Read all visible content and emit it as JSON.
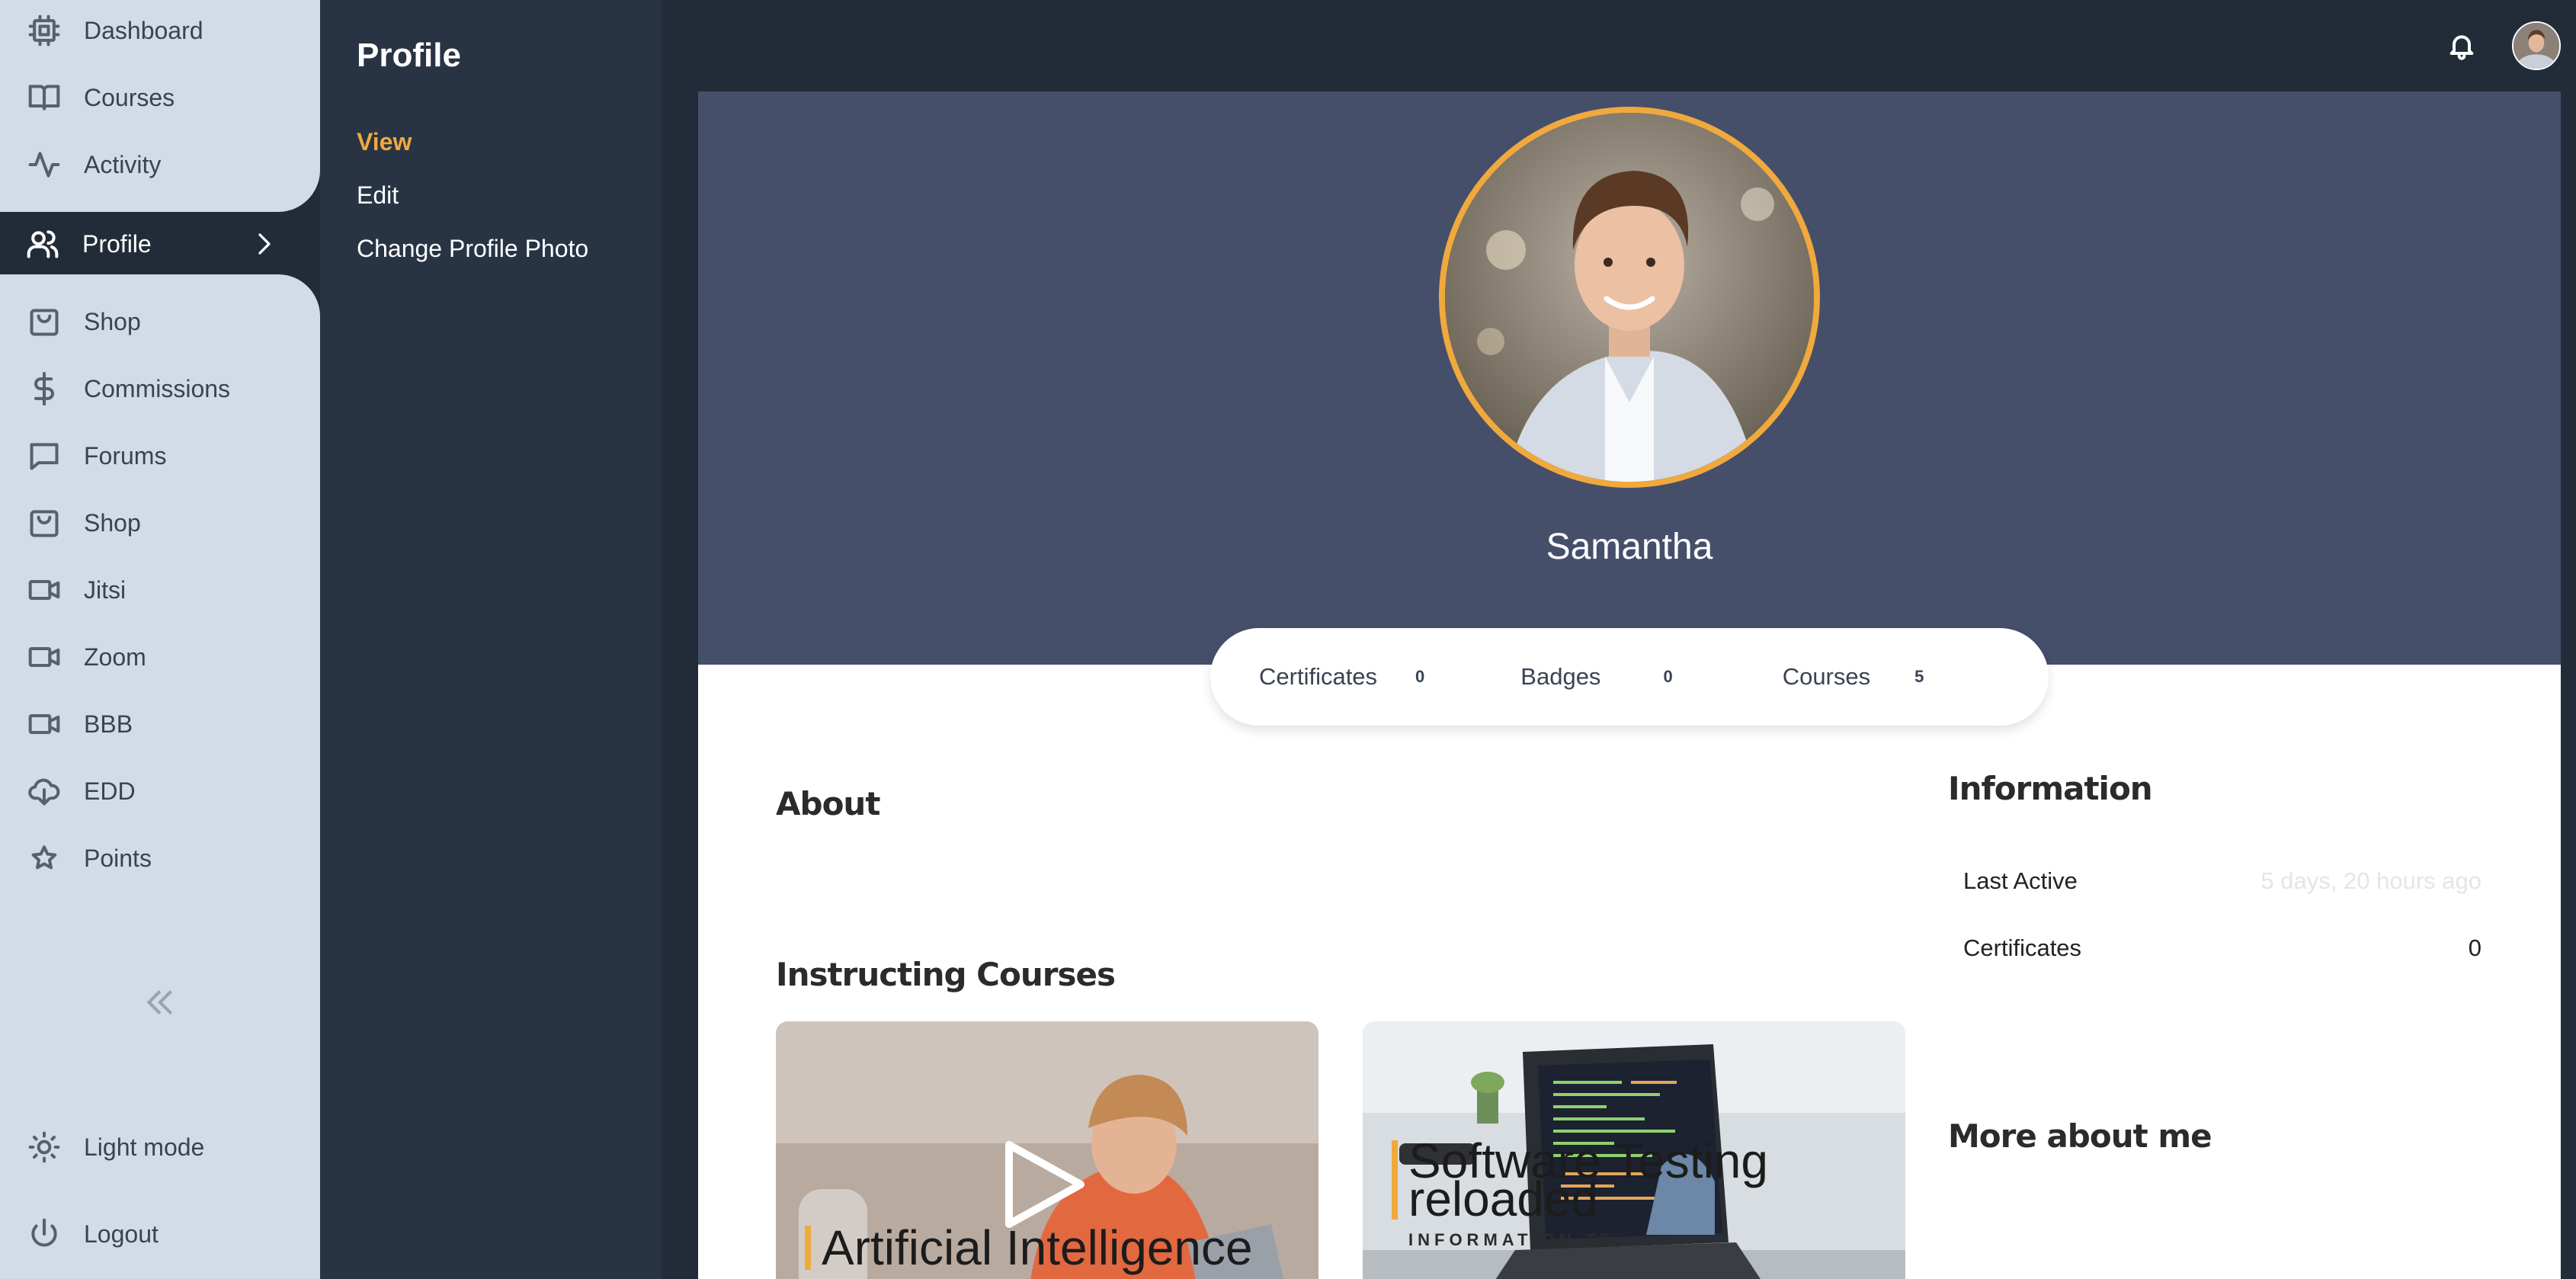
{
  "nav": {
    "items": [
      {
        "label": "Dashboard",
        "icon": "dashboard-icon"
      },
      {
        "label": "Courses",
        "icon": "book-icon"
      },
      {
        "label": "Activity",
        "icon": "activity-icon"
      },
      {
        "label": "Profile",
        "icon": "users-icon"
      },
      {
        "label": "Shop",
        "icon": "shopping-bag-icon"
      },
      {
        "label": "Commissions",
        "icon": "dollar-icon"
      },
      {
        "label": "Forums",
        "icon": "message-icon"
      },
      {
        "label": "Shop",
        "icon": "shopping-bag-icon"
      },
      {
        "label": "Jitsi",
        "icon": "video-icon"
      },
      {
        "label": "Zoom",
        "icon": "video-icon"
      },
      {
        "label": "BBB",
        "icon": "video-icon"
      },
      {
        "label": "EDD",
        "icon": "cloud-download-icon"
      },
      {
        "label": "Points",
        "icon": "star-icon"
      }
    ],
    "light_mode": "Light mode",
    "logout": "Logout"
  },
  "submenu": {
    "title": "Profile",
    "links": [
      "View",
      "Edit",
      "Change Profile Photo"
    ]
  },
  "profile": {
    "name": "Samantha",
    "stats": [
      {
        "label": "Certificates",
        "value": "0"
      },
      {
        "label": "Badges",
        "value": "0"
      },
      {
        "label": "Courses",
        "value": "5"
      }
    ]
  },
  "sections": {
    "about": "About",
    "instructing": "Instructing Courses",
    "information": "Information",
    "more_about": "More about me"
  },
  "information": {
    "last_active_label": "Last Active",
    "last_active_value": "5 days, 20 hours ago",
    "certificates_label": "Certificates",
    "certificates_value": "0"
  },
  "courses": [
    {
      "title": "Artificial Intelligence"
    },
    {
      "title_line1": "Software Testing",
      "title_line2": "reloaded",
      "category": "INFORMATION TE..."
    }
  ],
  "colors": {
    "accent": "#f0a93d",
    "nav_bg": "#d3dbe7",
    "dark_bg": "#222c39",
    "hero_bg": "#454f6a"
  }
}
